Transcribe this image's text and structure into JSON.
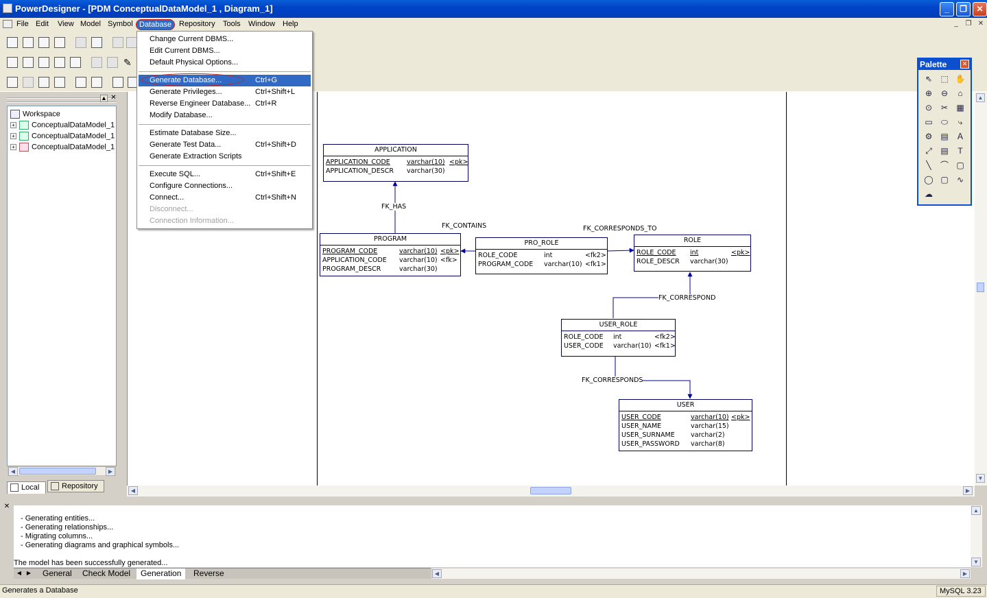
{
  "window": {
    "title": "PowerDesigner - [PDM ConceptualDataModel_1 , Diagram_1]",
    "minimize": "_",
    "maximize": "❐",
    "close": "✕"
  },
  "menubar": {
    "items": [
      "File",
      "Edit",
      "View",
      "Model",
      "Symbol",
      "Database",
      "Repository",
      "Tools",
      "Window",
      "Help"
    ],
    "active": "Database"
  },
  "database_menu": {
    "groups": [
      [
        {
          "label": "Change Current DBMS...",
          "shortcut": "",
          "enabled": true
        },
        {
          "label": "Edit Current DBMS...",
          "shortcut": "",
          "enabled": true
        },
        {
          "label": "Default Physical Options...",
          "shortcut": "",
          "enabled": true
        }
      ],
      [
        {
          "label": "Generate Database...",
          "shortcut": "Ctrl+G",
          "enabled": true,
          "selected": true
        },
        {
          "label": "Generate Privileges...",
          "shortcut": "Ctrl+Shift+L",
          "enabled": true
        },
        {
          "label": "Reverse Engineer Database...",
          "shortcut": "Ctrl+R",
          "enabled": true
        },
        {
          "label": "Modify Database...",
          "shortcut": "",
          "enabled": true
        }
      ],
      [
        {
          "label": "Estimate Database Size...",
          "shortcut": "",
          "enabled": true
        },
        {
          "label": "Generate Test Data...",
          "shortcut": "Ctrl+Shift+D",
          "enabled": true
        },
        {
          "label": "Generate Extraction Scripts",
          "shortcut": "",
          "enabled": true
        }
      ],
      [
        {
          "label": "Execute SQL...",
          "shortcut": "Ctrl+Shift+E",
          "enabled": true
        },
        {
          "label": "Configure Connections...",
          "shortcut": "",
          "enabled": true
        },
        {
          "label": "Connect...",
          "shortcut": "Ctrl+Shift+N",
          "enabled": true
        },
        {
          "label": "Disconnect...",
          "shortcut": "",
          "enabled": false
        },
        {
          "label": "Connection Information...",
          "shortcut": "",
          "enabled": false
        }
      ]
    ]
  },
  "browser": {
    "root": "Workspace",
    "items": [
      "ConceptualDataModel_1",
      "ConceptualDataModel_1",
      "ConceptualDataModel_1"
    ],
    "tabs": [
      "Local",
      "Repository"
    ]
  },
  "palette": {
    "title": "Palette",
    "tools": [
      "pointer-icon",
      "lasso-icon",
      "grabber-icon",
      "zoom-in-icon",
      "zoom-out-icon",
      "open-package-icon",
      "properties-icon",
      "delete-icon",
      "package-icon",
      "table-icon",
      "view-icon",
      "reference-icon",
      "procedure-icon",
      "file-icon",
      "text-icon",
      "link-icon",
      "note-icon",
      "title-icon",
      "line-icon",
      "arc-icon",
      "rectangle-icon",
      "ellipse-icon",
      "rounded-rect-icon",
      "polyline-icon",
      "polygon-icon"
    ]
  },
  "diagram": {
    "entities": [
      {
        "name": "APPLICATION",
        "columns": [
          {
            "name": "APPLICATION_CODE",
            "type": "varchar(10)",
            "key": "<pk>",
            "pk": true
          },
          {
            "name": "APPLICATION_DESCR",
            "type": "varchar(30)",
            "key": "",
            "pk": false
          }
        ]
      },
      {
        "name": "PROGRAM",
        "columns": [
          {
            "name": "PROGRAM_CODE",
            "type": "varchar(10)",
            "key": "<pk>",
            "pk": true
          },
          {
            "name": "APPLICATION_CODE",
            "type": "varchar(10)",
            "key": "<fk>",
            "pk": false
          },
          {
            "name": "PROGRAM_DESCR",
            "type": "varchar(30)",
            "key": "",
            "pk": false
          }
        ]
      },
      {
        "name": "PRO_ROLE",
        "columns": [
          {
            "name": "ROLE_CODE",
            "type": "int",
            "key": "<fk2>",
            "pk": false
          },
          {
            "name": "PROGRAM_CODE",
            "type": "varchar(10)",
            "key": "<fk1>",
            "pk": false
          }
        ]
      },
      {
        "name": "ROLE",
        "columns": [
          {
            "name": "ROLE_CODE",
            "type": "int",
            "key": "<pk>",
            "pk": true
          },
          {
            "name": "ROLE_DESCR",
            "type": "varchar(30)",
            "key": "",
            "pk": false
          }
        ]
      },
      {
        "name": "USER_ROLE",
        "columns": [
          {
            "name": "ROLE_CODE",
            "type": "int",
            "key": "<fk2>",
            "pk": false
          },
          {
            "name": "USER_CODE",
            "type": "varchar(10)",
            "key": "<fk1>",
            "pk": false
          }
        ]
      },
      {
        "name": "USER",
        "columns": [
          {
            "name": "USER_CODE",
            "type": "varchar(10)",
            "key": "<pk>",
            "pk": true
          },
          {
            "name": "USER_NAME",
            "type": "varchar(15)",
            "key": "",
            "pk": false
          },
          {
            "name": "USER_SURNAME",
            "type": "varchar(2)",
            "key": "",
            "pk": false
          },
          {
            "name": "USER_PASSWORD",
            "type": "varchar(8)",
            "key": "",
            "pk": false
          }
        ]
      }
    ],
    "references": [
      "FK_HAS",
      "FK_CONTAINS",
      "FK_CORRESPONDS_TO",
      "FK_CORRESPOND",
      "FK_CORRESPONDS"
    ]
  },
  "output": {
    "lines": [
      "- Generating entities...",
      "- Generating relationships...",
      "- Migrating columns...",
      "- Generating diagrams and graphical symbols...",
      "",
      "The model has been successfully generated..."
    ],
    "tabs": [
      "General",
      "Check Model",
      "Generation",
      "Reverse"
    ],
    "active_tab": "Generation"
  },
  "status": {
    "message": "Generates a Database",
    "dbms": "MySQL 3.23"
  }
}
